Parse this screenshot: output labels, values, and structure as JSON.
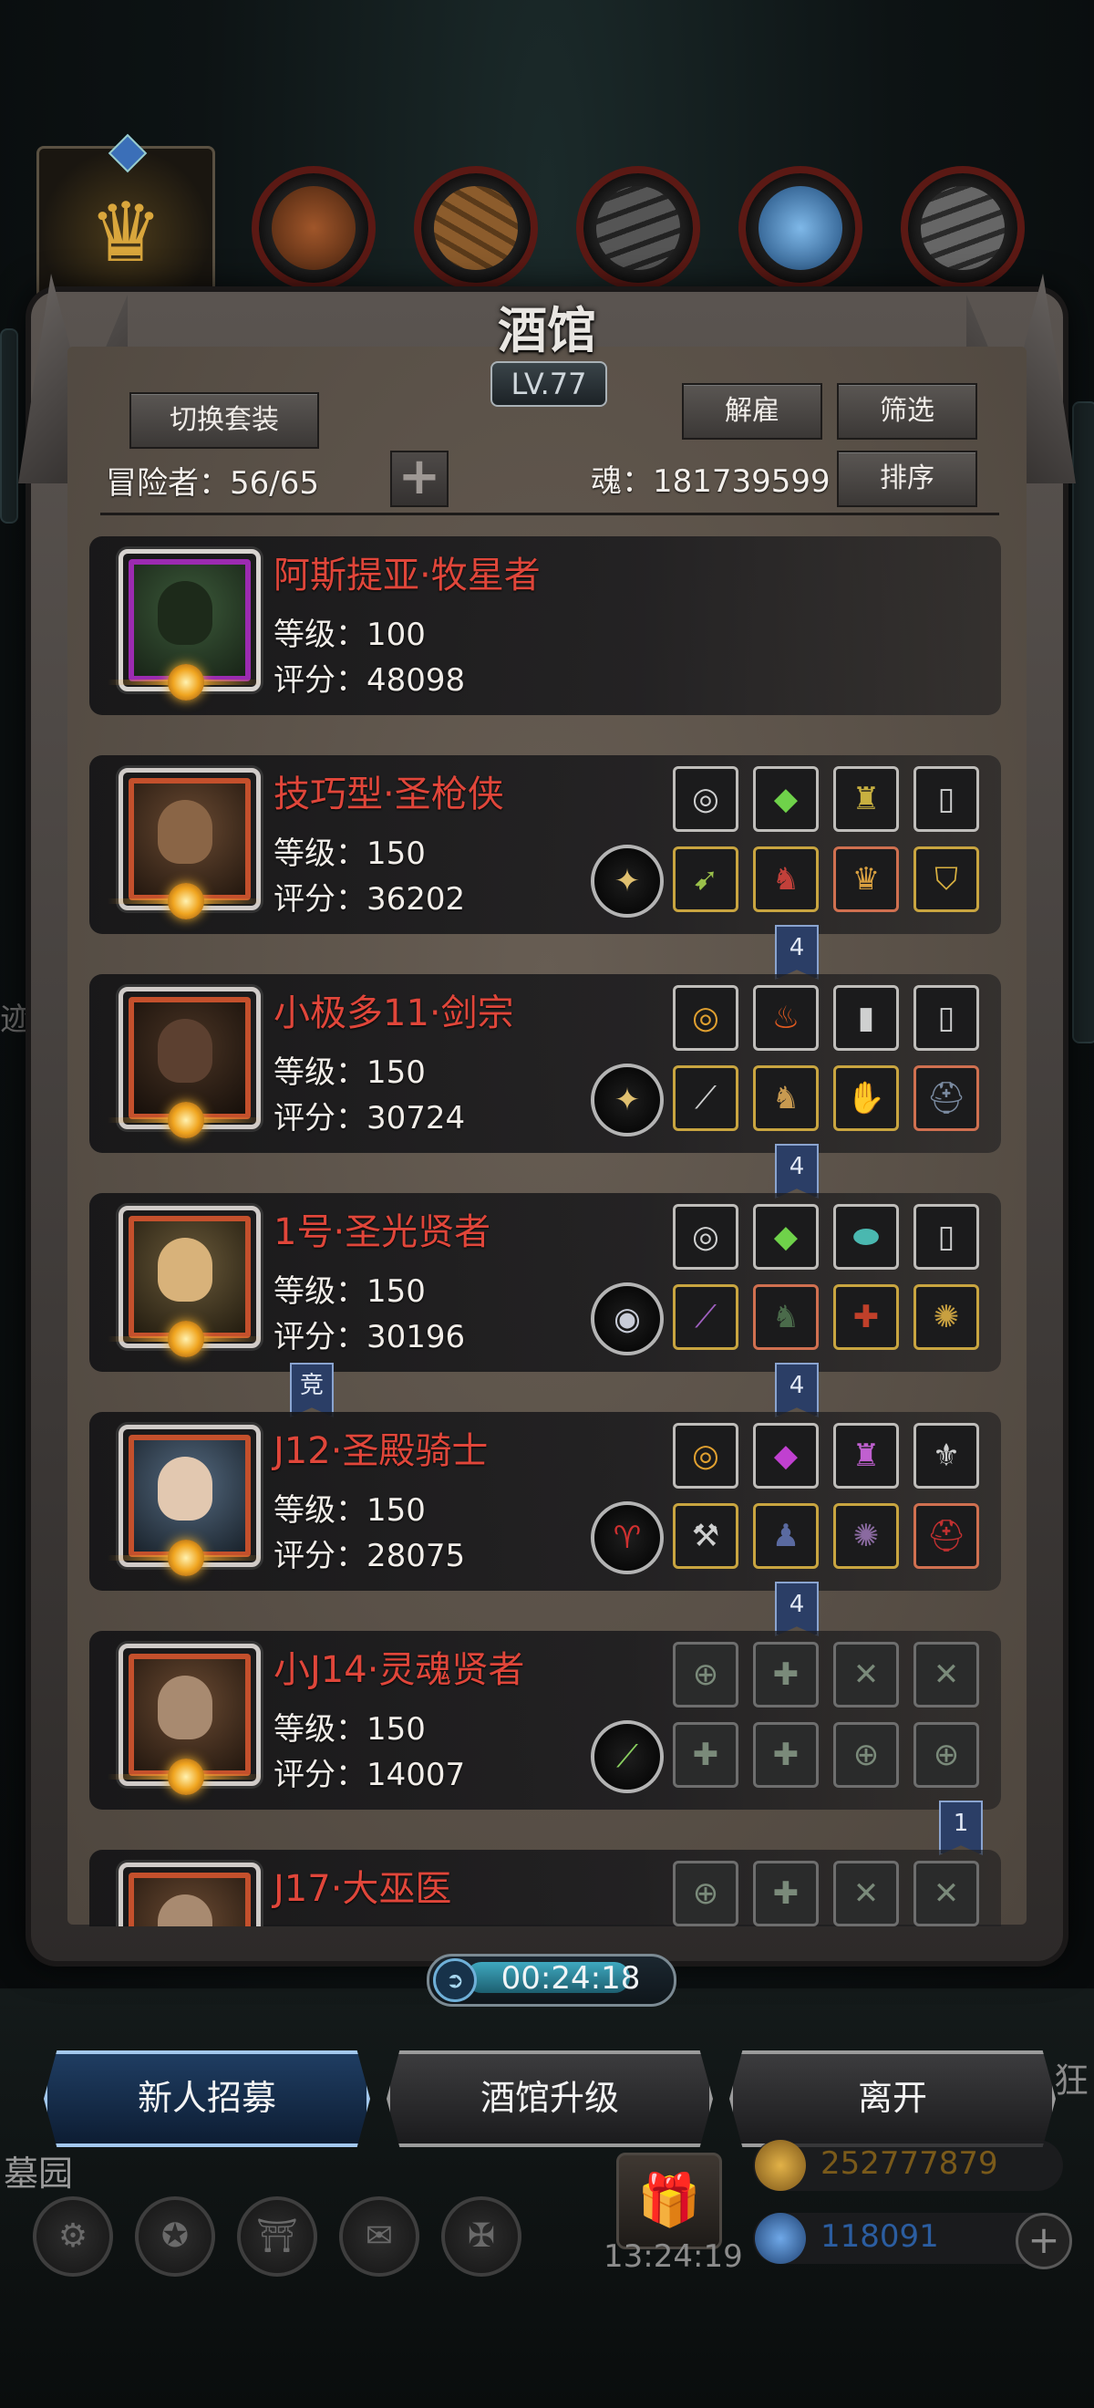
{
  "window": {
    "title": "酒馆",
    "level": "LV.77"
  },
  "toolbar": {
    "switch_outfit": "切换套装",
    "dismiss": "解雇",
    "filter": "筛选",
    "sort": "排序",
    "add": "+"
  },
  "stats": {
    "adventurers_label": "冒险者：56/65",
    "soul_label": "魂：181739599"
  },
  "heroes": [
    {
      "name": "阿斯提亚·牧星者",
      "level": "等级：100",
      "score": "评分：48098"
    },
    {
      "name": "技巧型·圣枪侠",
      "level": "等级：150",
      "score": "评分：36202",
      "set_count": "4"
    },
    {
      "name": "小极多11·剑宗",
      "level": "等级：150",
      "score": "评分：30724",
      "set_count": "4"
    },
    {
      "name": "1号·圣光贤者",
      "level": "等级：150",
      "score": "评分：30196",
      "set_count": "4",
      "tag": "竞"
    },
    {
      "name": "J12·圣殿骑士",
      "level": "等级：150",
      "score": "评分：28075",
      "set_count": "4"
    },
    {
      "name": "小J14·灵魂贤者",
      "level": "等级：150",
      "score": "评分：14007",
      "set_count": "1"
    },
    {
      "name": "J17·大巫医"
    }
  ],
  "timer": {
    "value": "00:24:18"
  },
  "actions": {
    "recruit": "新人招募",
    "upgrade": "酒馆升级",
    "leave": "离开"
  },
  "scene": {
    "cemetery": "墓园",
    "gift_timer": "13:24:19",
    "gold": "252777879",
    "gems": "118091",
    "side_char_1": "迹",
    "side_char_2": "狂"
  },
  "colors": {
    "hero_name": "#e0463a",
    "gold_text": "#7a5a1a",
    "gem_text": "#2b5da0",
    "primary_button_glow": "#5c9ad8"
  }
}
